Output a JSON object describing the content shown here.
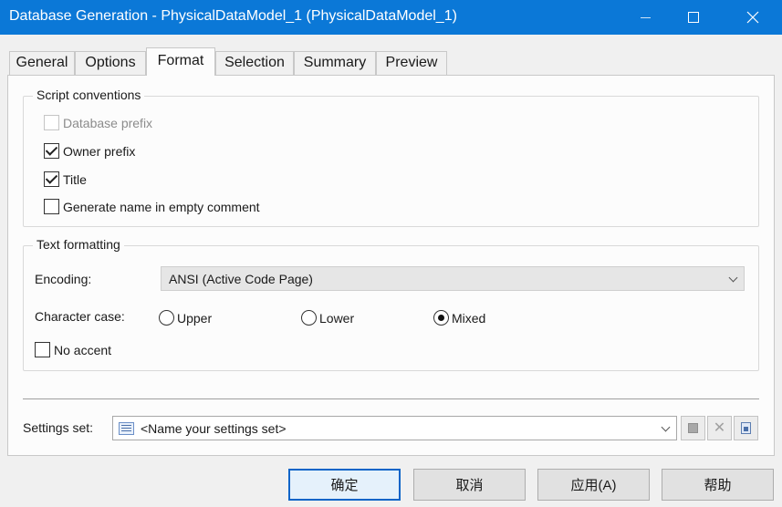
{
  "window": {
    "title": "Database Generation - PhysicalDataModel_1 (PhysicalDataModel_1)"
  },
  "tabs": [
    {
      "label": "General",
      "active": false
    },
    {
      "label": "Options",
      "active": false
    },
    {
      "label": "Format",
      "active": true
    },
    {
      "label": "Selection",
      "active": false
    },
    {
      "label": "Summary",
      "active": false
    },
    {
      "label": "Preview",
      "active": false
    }
  ],
  "script_conventions": {
    "label": "Script conventions",
    "database_prefix": {
      "label": "Database prefix",
      "checked": false,
      "disabled": true
    },
    "owner_prefix": {
      "label": "Owner prefix",
      "checked": true
    },
    "title": {
      "label": "Title",
      "checked": true
    },
    "generate_name": {
      "label": "Generate name in empty comment",
      "checked": false
    }
  },
  "text_formatting": {
    "label": "Text formatting",
    "encoding_label": "Encoding:",
    "encoding_value": "ANSI (Active Code Page)",
    "character_case_label": "Character case:",
    "case_options": [
      {
        "label": "Upper",
        "checked": false
      },
      {
        "label": "Lower",
        "checked": false
      },
      {
        "label": "Mixed",
        "checked": true
      }
    ],
    "no_accent": {
      "label": "No accent",
      "checked": false
    }
  },
  "settings_set": {
    "label": "Settings set:",
    "value": "<Name your settings set>"
  },
  "buttons": {
    "ok": "确定",
    "cancel": "取消",
    "apply": "应用(A)",
    "help": "帮助"
  },
  "colors": {
    "titlebar": "#0b78d7",
    "default_button_border": "#0a64c8"
  }
}
